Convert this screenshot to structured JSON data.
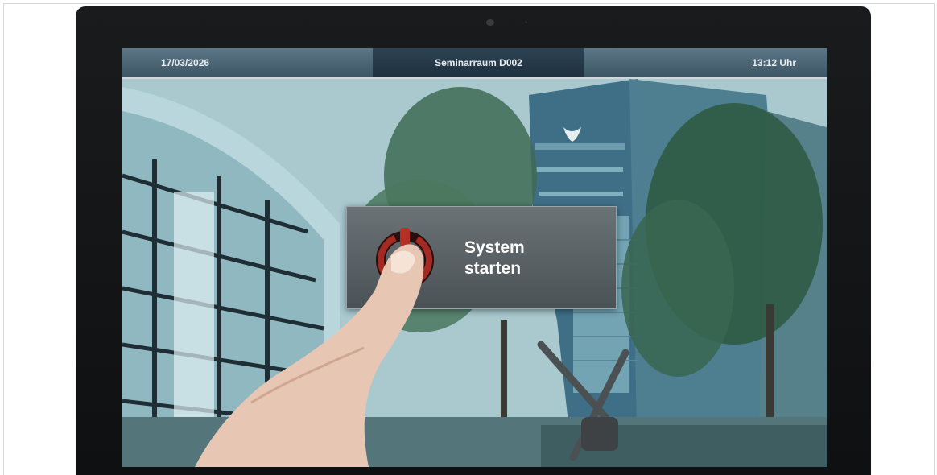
{
  "status_bar": {
    "date": "17/03/2026",
    "room": "Seminarraum D002",
    "time": "13:12 Uhr"
  },
  "power_button": {
    "icon": "power-icon",
    "label": "System\nstarten"
  },
  "colors": {
    "status_bar_bg": "#3a4f5c",
    "dialog_bg": "#555c60",
    "power_ring": "#9c2a22",
    "label_text": "#ffffff"
  }
}
